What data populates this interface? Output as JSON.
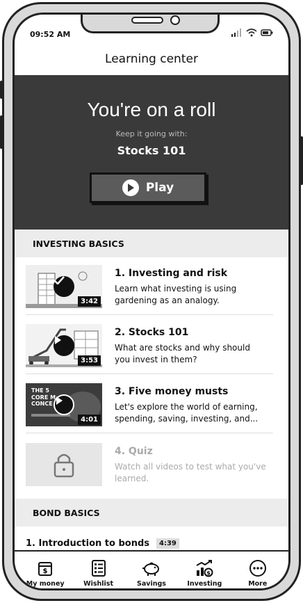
{
  "status_bar": {
    "time": "09:52 AM"
  },
  "header": {
    "title": "Learning center"
  },
  "hero": {
    "title": "You're on a roll",
    "subtitle": "Keep it going with:",
    "course": "Stocks 101",
    "play_label": "Play"
  },
  "sections": [
    {
      "title": "INVESTING BASICS",
      "items": [
        {
          "title": "1. Investing and risk",
          "desc": "Learn what investing is using gardening as an analogy.",
          "duration": "3:42",
          "status_icon": "check-icon"
        },
        {
          "title": "2. Stocks 101",
          "desc": "What are stocks and why should you invest in them?",
          "duration": "3:53",
          "status_icon": "play-icon"
        },
        {
          "title": "3. Five money musts",
          "desc": "Let's explore the world of earning, spending, saving, investing, and...",
          "duration": "4:01",
          "status_icon": "play-icon"
        },
        {
          "title": "4. Quiz",
          "desc": "Watch all videos to test what you've learned.",
          "status_icon": "lock-icon"
        }
      ]
    },
    {
      "title": "BOND BASICS",
      "items": [
        {
          "title": "1. Introduction to bonds",
          "duration": "4:39"
        }
      ]
    }
  ],
  "bottom_nav": [
    {
      "label": "My money",
      "icon": "wallet-dollar-icon"
    },
    {
      "label": "Wishlist",
      "icon": "checklist-icon"
    },
    {
      "label": "Savings",
      "icon": "piggy-bank-icon"
    },
    {
      "label": "Investing",
      "icon": "growth-chart-icon"
    },
    {
      "label": "More",
      "icon": "more-dots-icon"
    }
  ],
  "thumb_texts": {
    "third_thumb_text": "THE 5 CORE M CONCE"
  }
}
